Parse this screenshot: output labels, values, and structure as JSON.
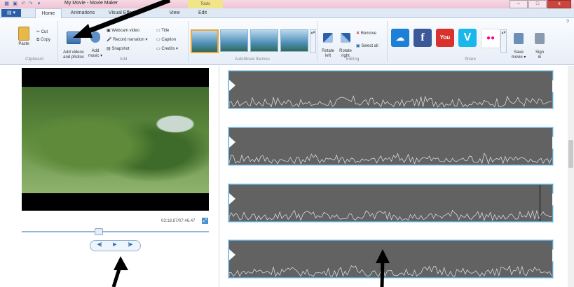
{
  "window": {
    "title": "My Movie - Movie Maker",
    "contextual_tab": "Tools",
    "controls": [
      "–",
      "□",
      "x"
    ]
  },
  "tabs": {
    "file": "▤ ▾",
    "items": [
      "Home",
      "Animations",
      "Visual Effects",
      "View",
      "Edit"
    ]
  },
  "ribbon": {
    "clipboard": {
      "paste": "Paste",
      "cut": "Cut",
      "copy": "Copy",
      "label": "Clipboard"
    },
    "add": {
      "add_videos": "Add videos\nand photos",
      "add_music": "Add\nmusic ▾",
      "webcam": "Webcam video",
      "narration": "Record narration ▾",
      "snapshot": "Snapshot",
      "title": "Title",
      "caption": "Caption",
      "credits": "Credits ▾",
      "label": "Add"
    },
    "automovie": {
      "label": "AutoMovie themes"
    },
    "editing": {
      "rotate_left": "Rotate\nleft",
      "rotate_right": "Rotate\nright",
      "remove": "Remove",
      "select_all": "Select all",
      "label": "Editing"
    },
    "share": {
      "label": "Share",
      "services": [
        {
          "name": "onedrive",
          "glyph": "☁",
          "color": "#1e7fd6"
        },
        {
          "name": "facebook",
          "glyph": "f",
          "color": "#3b5998"
        },
        {
          "name": "youtube",
          "glyph": "You",
          "color": "#d7322d"
        },
        {
          "name": "vimeo",
          "glyph": "V",
          "color": "#1ab7ea"
        },
        {
          "name": "flickr",
          "glyph": "●●",
          "color": "#ffffff"
        }
      ],
      "save_movie": "Save\nmovie ▾",
      "sign_in": "Sign\nin"
    }
  },
  "preview": {
    "timecode": "03:18.87/07:46.47",
    "seek_fraction": 0.41,
    "controls": {
      "prev": "◀|",
      "play": "▶",
      "next": "|▶"
    }
  },
  "storyboard": {
    "clips": [
      {
        "cursor": false
      },
      {
        "cursor": false
      },
      {
        "cursor": true
      },
      {
        "cursor": false
      }
    ]
  }
}
